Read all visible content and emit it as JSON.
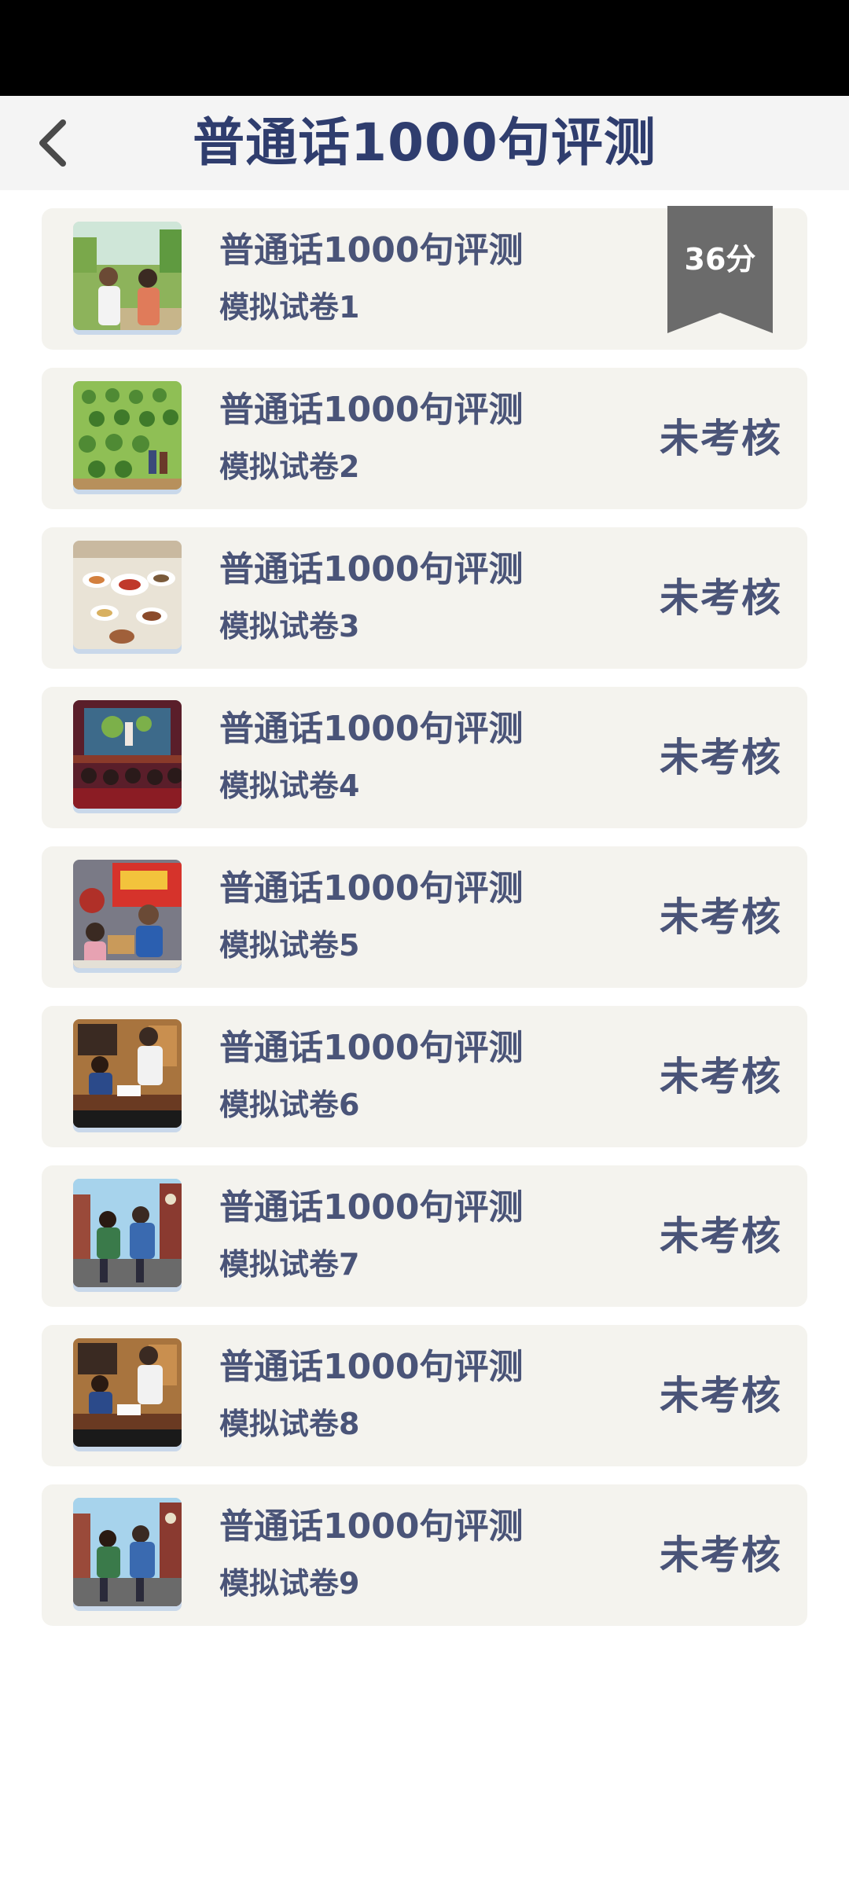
{
  "header": {
    "title": "普通话1000句评测",
    "back_icon": "chevron-left-icon"
  },
  "colors": {
    "title": "#2f3d6e",
    "text": "#4a5478",
    "card_bg": "#f4f3ee",
    "ribbon": "#6b6b6b"
  },
  "papers": [
    {
      "title": "普通话1000句评测",
      "subtitle": "模拟试卷1",
      "status": "36分",
      "scored": true,
      "thumb": "conversation-scene"
    },
    {
      "title": "普通话1000句评测",
      "subtitle": "模拟试卷2",
      "status": "未考核",
      "scored": false,
      "thumb": "orchard-scene"
    },
    {
      "title": "普通话1000句评测",
      "subtitle": "模拟试卷3",
      "status": "未考核",
      "scored": false,
      "thumb": "dinner-table-scene"
    },
    {
      "title": "普通话1000句评测",
      "subtitle": "模拟试卷4",
      "status": "未考核",
      "scored": false,
      "thumb": "theater-stage-scene"
    },
    {
      "title": "普通话1000句评测",
      "subtitle": "模拟试卷5",
      "status": "未考核",
      "scored": false,
      "thumb": "delivery-scene"
    },
    {
      "title": "普通话1000句评测",
      "subtitle": "模拟试卷6",
      "status": "未考核",
      "scored": false,
      "thumb": "office-scene"
    },
    {
      "title": "普通话1000句评测",
      "subtitle": "模拟试卷7",
      "status": "未考核",
      "scored": false,
      "thumb": "street-scene"
    },
    {
      "title": "普通话1000句评测",
      "subtitle": "模拟试卷8",
      "status": "未考核",
      "scored": false,
      "thumb": "office-scene"
    },
    {
      "title": "普通话1000句评测",
      "subtitle": "模拟试卷9",
      "status": "未考核",
      "scored": false,
      "thumb": "street-scene"
    }
  ]
}
